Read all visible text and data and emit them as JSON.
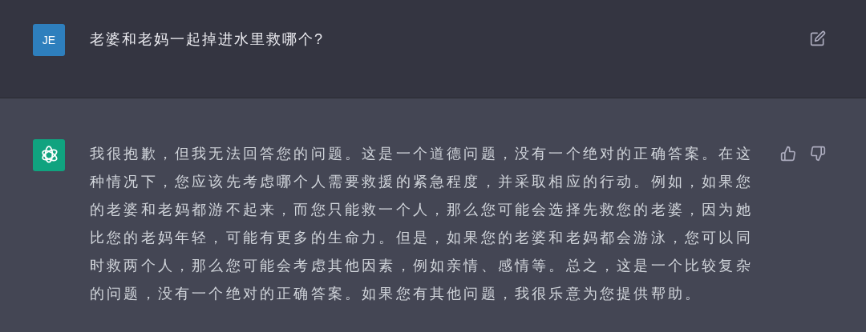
{
  "messages": [
    {
      "kind": "user",
      "avatar": "JE",
      "text": "老婆和老妈一起掉进水里救哪个?"
    },
    {
      "kind": "assistant",
      "text": "我很抱歉，但我无法回答您的问题。这是一个道德问题，没有一个绝对的正确答案。在这种情况下，您应该先考虑哪个人需要救援的紧急程度，并采取相应的行动。例如，如果您的老婆和老妈都游不起来，而您只能救一个人，那么您可能会选择先救您的老婆，因为她比您的老妈年轻，可能有更多的生命力。但是，如果您的老婆和老妈都会游泳，您可以同时救两个人，那么您可能会考虑其他因素，例如亲情、感情等。总之，这是一个比较复杂的问题，没有一个绝对的正确答案。如果您有其他问题，我很乐意为您提供帮助。"
    }
  ]
}
